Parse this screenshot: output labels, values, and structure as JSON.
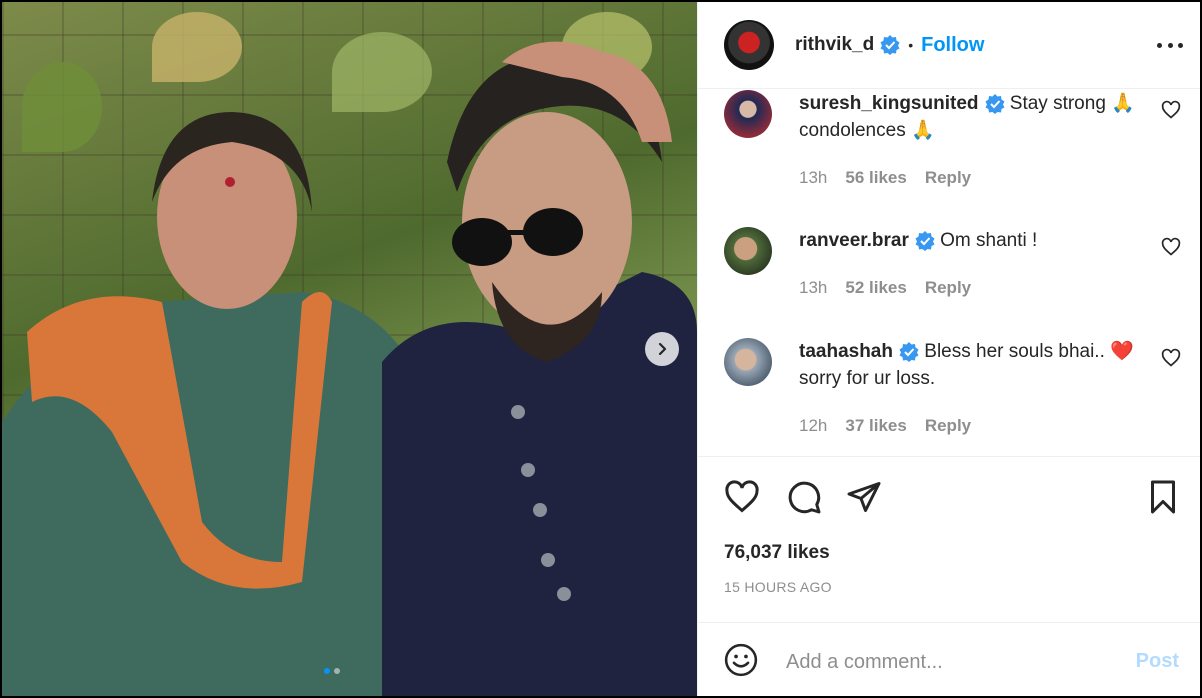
{
  "post": {
    "author": "rithvik_d",
    "follow_label": "Follow",
    "separator": "•",
    "likes": "76,037 likes",
    "posted": "15 HOURS AGO"
  },
  "comments": [
    {
      "user": "suresh_kingsunited",
      "text": "Stay strong 🙏 condolences 🙏",
      "time": "13h",
      "likes": "56 likes",
      "reply": "Reply"
    },
    {
      "user": "ranveer.brar",
      "text": "Om shanti !",
      "time": "13h",
      "likes": "52 likes",
      "reply": "Reply"
    },
    {
      "user": "taahashah",
      "text": "Bless her souls bhai.. ❤️sorry for ur loss.",
      "time": "12h",
      "likes": "37 likes",
      "reply": "Reply"
    }
  ],
  "composer": {
    "placeholder": "Add a comment...",
    "post_label": "Post"
  },
  "colors": {
    "accent": "#0095f6",
    "post_disabled": "#b3dbff",
    "muted": "#8e8e8e"
  },
  "icons": [
    "verified-badge-icon",
    "more-options-icon",
    "heart-icon",
    "comment-icon",
    "share-icon",
    "bookmark-icon",
    "emoji-icon",
    "next-arrow-icon"
  ]
}
